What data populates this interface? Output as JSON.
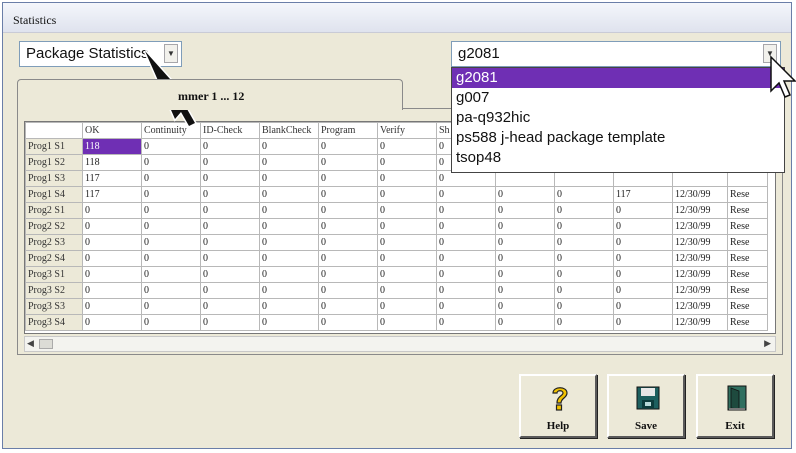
{
  "window": {
    "title": "Statistics"
  },
  "view_selector": {
    "value": "Package Statistics"
  },
  "package_selector": {
    "value": "g2081",
    "options": [
      "g2081",
      "g007",
      "pa-q932hic",
      "ps588 j-head package template",
      "tsop48"
    ],
    "selected_index": 0
  },
  "tab": {
    "label": "mmer 1 ... 12"
  },
  "table": {
    "headers": [
      "",
      "OK",
      "Continuity",
      "ID-Check",
      "BlankCheck",
      "Program",
      "Verify",
      "Sh",
      "",
      "",
      "",
      "",
      ""
    ],
    "rows": [
      [
        "Prog1 S1",
        "118",
        "0",
        "0",
        "0",
        "0",
        "0",
        "0",
        "",
        "",
        "",
        "",
        ""
      ],
      [
        "Prog1 S2",
        "118",
        "0",
        "0",
        "0",
        "0",
        "0",
        "0",
        "",
        "",
        "",
        "",
        ""
      ],
      [
        "Prog1 S3",
        "117",
        "0",
        "0",
        "0",
        "0",
        "0",
        "0",
        "",
        "",
        "",
        "",
        ""
      ],
      [
        "Prog1 S4",
        "117",
        "0",
        "0",
        "0",
        "0",
        "0",
        "0",
        "0",
        "0",
        "117",
        "12/30/99",
        "Rese"
      ],
      [
        "Prog2 S1",
        "0",
        "0",
        "0",
        "0",
        "0",
        "0",
        "0",
        "0",
        "0",
        "0",
        "12/30/99",
        "Rese"
      ],
      [
        "Prog2 S2",
        "0",
        "0",
        "0",
        "0",
        "0",
        "0",
        "0",
        "0",
        "0",
        "0",
        "12/30/99",
        "Rese"
      ],
      [
        "Prog2 S3",
        "0",
        "0",
        "0",
        "0",
        "0",
        "0",
        "0",
        "0",
        "0",
        "0",
        "12/30/99",
        "Rese"
      ],
      [
        "Prog2 S4",
        "0",
        "0",
        "0",
        "0",
        "0",
        "0",
        "0",
        "0",
        "0",
        "0",
        "12/30/99",
        "Rese"
      ],
      [
        "Prog3 S1",
        "0",
        "0",
        "0",
        "0",
        "0",
        "0",
        "0",
        "0",
        "0",
        "0",
        "12/30/99",
        "Rese"
      ],
      [
        "Prog3 S2",
        "0",
        "0",
        "0",
        "0",
        "0",
        "0",
        "0",
        "0",
        "0",
        "0",
        "12/30/99",
        "Rese"
      ],
      [
        "Prog3 S3",
        "0",
        "0",
        "0",
        "0",
        "0",
        "0",
        "0",
        "0",
        "0",
        "0",
        "12/30/99",
        "Rese"
      ],
      [
        "Prog3 S4",
        "0",
        "0",
        "0",
        "0",
        "0",
        "0",
        "0",
        "0",
        "0",
        "0",
        "12/30/99",
        "Rese"
      ]
    ]
  },
  "buttons": {
    "help": "Help",
    "save": "Save",
    "exit": "Exit"
  },
  "icons": {
    "combo_arrow": "chevron-down-icon",
    "help": "question-mark-icon",
    "save": "floppy-disk-icon",
    "exit": "exit-door-icon",
    "pointer": "mouse-pointer-icon"
  },
  "colors": {
    "selection": "#6f2fb4",
    "window_bg": "#ece9d8"
  }
}
